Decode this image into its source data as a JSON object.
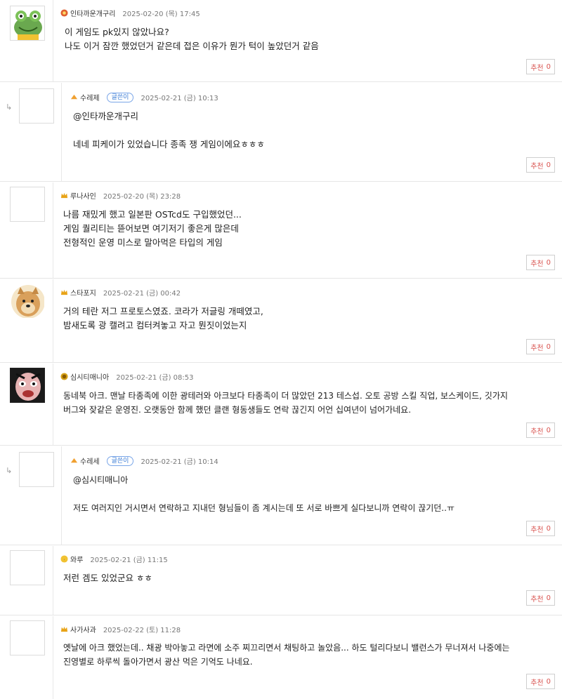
{
  "comments": [
    {
      "nick": "인타까운개구리",
      "date": "2025-02-20 (목) 17:45",
      "lines": [
        "이 게임도 pk있지 않았나요?",
        "나도 이거 잠깐 했었던거 같은데 접은 이유가 뭔가 턱이 높았던거 같음"
      ],
      "rec_label": "추천",
      "rec_count": "0",
      "avatar": "frog-avatar"
    },
    {
      "nick": "수레제",
      "badge": "글쓴이",
      "date": "2025-02-21 (금) 10:13",
      "lines": [
        "@인타까운개구리",
        "",
        "네네 피케이가 있었습니다 종족 쟁 게임이에요ㅎㅎㅎ"
      ],
      "rec_label": "추천",
      "rec_count": "0",
      "reply": true
    },
    {
      "nick": "루나사인",
      "date": "2025-02-20 (목) 23:28",
      "lines": [
        "나름 재밌게 했고 일본판 OSTcd도 구입했었던...",
        "게임 퀄리티는 뜯어보면 여기저기 좋은게 많은데",
        "전형적인 운영 미스로 말아먹은 타입의 게임"
      ],
      "rec_label": "추천",
      "rec_count": "0"
    },
    {
      "nick": "스타포지",
      "date": "2025-02-21 (금) 00:42",
      "lines": [
        "거의 테란 저그 프로토스였죠. 코라가 저글링 개떼였고,",
        "밤새도록 광 캘려고 컴터켜놓고 자고 뭔짓이었는지"
      ],
      "rec_label": "추천",
      "rec_count": "0",
      "avatar": "doge-avatar"
    },
    {
      "nick": "심시티매니아",
      "date": "2025-02-21 (금) 08:53",
      "lines": [
        "동네북 아크. 맨날 타종족에 이한 광테러와 아크보다 타종족이 더 많았던 213 테스섭. 오토 공방 스킬 직업, 보스케이드, 깃가지",
        "버그와 잦같은 운영진. 오랫동안 함께 했던 클랜 형동생들도 연락 끊긴지 어언 십여년이 넘어가네요."
      ],
      "rec_label": "추천",
      "rec_count": "0",
      "avatar": "face-avatar"
    },
    {
      "nick": "수레세",
      "badge": "글쓴이",
      "date": "2025-02-21 (금) 10:14",
      "lines": [
        "@심시티매니아",
        "",
        "저도 여러지인 거시면서 연락하고 지내던 형님들이 좀 계시는데 또 서로 바쁘게 실다보니까 연락이 끊기던..ㅠ"
      ],
      "rec_label": "추천",
      "rec_count": "0",
      "reply": true
    },
    {
      "nick": "와루",
      "date": "2025-02-21 (금) 11:15",
      "lines": [
        "저런 겜도 있었군요 ㅎㅎ"
      ],
      "rec_label": "추천",
      "rec_count": "0"
    },
    {
      "nick": "사가사과",
      "date": "2025-02-22 (토) 11:28",
      "lines": [
        "옛날에 아크 했었는데.. 채광 박아놓고 라면에 소주 찌끄리면서 채팅하고 놀았음... 하도 털리다보니 밸런스가 무너져서 나중에는",
        "진영별로 하루씩 돌아가면서 광산 먹은 기억도 나네요."
      ],
      "rec_label": "추천",
      "rec_count": "0"
    }
  ],
  "colors": {
    "badge": "#3a7bd5",
    "recommend": "#d9534f",
    "level_icon": "#e8a317"
  }
}
